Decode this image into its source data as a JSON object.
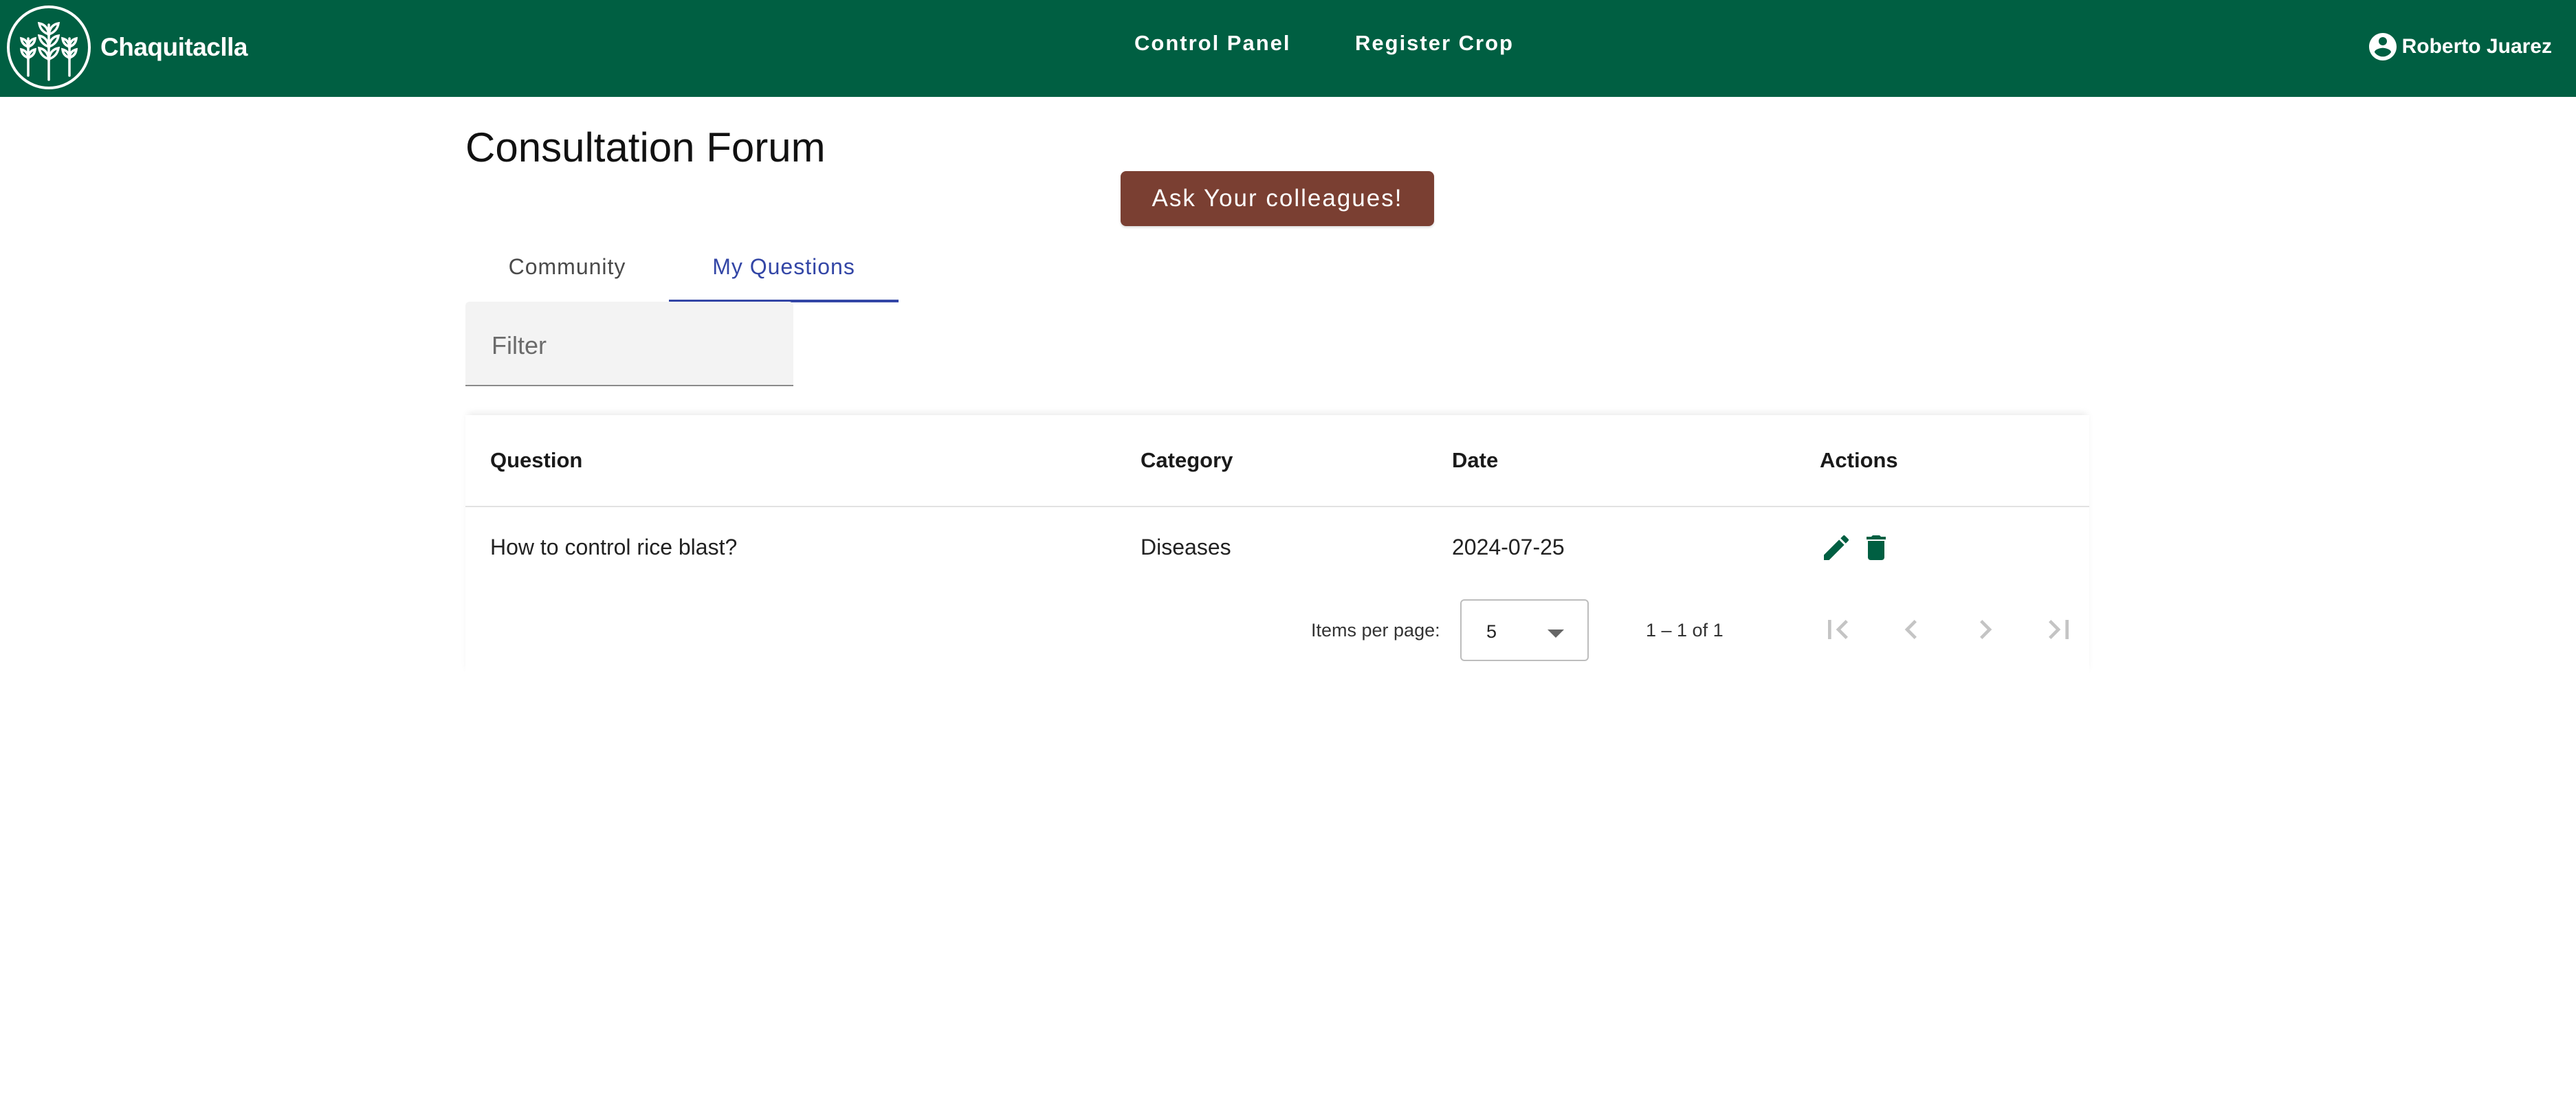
{
  "nav": {
    "brand": "Chaquitaclla",
    "links": [
      "Control Panel",
      "Register Crop"
    ],
    "user_name": "Roberto Juarez"
  },
  "page": {
    "title": "Consultation Forum",
    "ask_button": "Ask Your colleagues!"
  },
  "tabs": [
    {
      "label": "Community",
      "active": false
    },
    {
      "label": "My Questions",
      "active": true
    }
  ],
  "filter": {
    "placeholder": "Filter",
    "value": ""
  },
  "table": {
    "columns": [
      "Question",
      "Category",
      "Date",
      "Actions"
    ],
    "rows": [
      {
        "question": "How to control rice blast?",
        "category": "Diseases",
        "date": "2024-07-25",
        "actions": [
          "edit-icon",
          "delete-icon"
        ]
      }
    ]
  },
  "paginator": {
    "items_per_page_label": "Items per page:",
    "items_per_page": "5",
    "range_label": "1 – 1 of 1"
  },
  "colors": {
    "primary": "#005f42",
    "accent_button": "#7a3f32",
    "active_tab": "#3346a6"
  }
}
